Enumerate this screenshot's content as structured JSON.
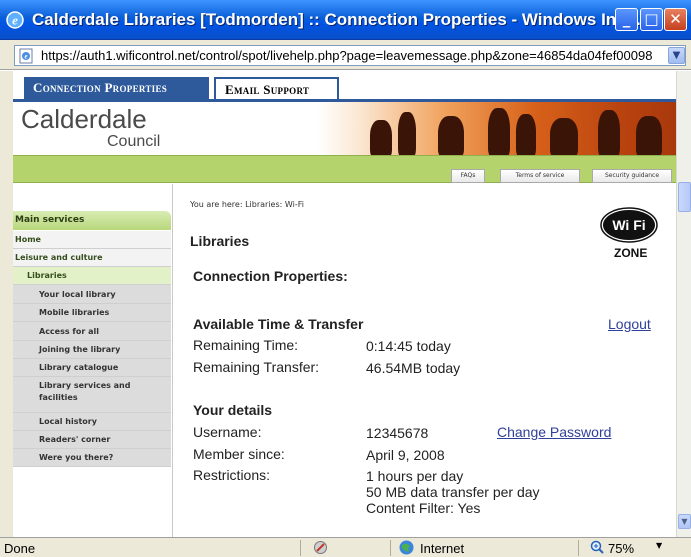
{
  "window": {
    "title": "Calderdale Libraries [Todmorden] :: Connection Properties - Windows Inte...",
    "min_glyph": "_",
    "max_glyph": "□",
    "close_glyph": "✕"
  },
  "address_bar": {
    "url": "https://auth1.wificontrol.net/control/spot/livehelp.php?page=leavemessage.php&zone=46854da04fef00098",
    "dropdown_glyph": "▼"
  },
  "tabs": [
    {
      "label": "Connection Properties"
    },
    {
      "label": "Email Support"
    }
  ],
  "header": {
    "logo_line1": "Calderdale",
    "logo_line2": "Council"
  },
  "top_nav": [
    {
      "label": "FAQs"
    },
    {
      "label": "Terms of service"
    },
    {
      "label": "Security guidance"
    }
  ],
  "sidebar": {
    "heading": "Main services",
    "items": [
      {
        "label": "Home"
      },
      {
        "label": "Leisure and culture"
      },
      {
        "label": "Libraries"
      },
      {
        "label": "Your local library"
      },
      {
        "label": "Mobile libraries"
      },
      {
        "label": "Access for all"
      },
      {
        "label": "Joining the library"
      },
      {
        "label": "Library catalogue"
      },
      {
        "label": "Library services and facilities"
      },
      {
        "label": "Local history"
      },
      {
        "label": "Readers' corner"
      },
      {
        "label": "Were you there?"
      }
    ]
  },
  "main": {
    "breadcrumb": "You are here: Libraries: Wi-Fi",
    "title": "Libraries",
    "section_connection": "Connection Properties:",
    "section_time": "Available Time & Transfer",
    "logout_label": "Logout",
    "remaining_time_label": "Remaining Time:",
    "remaining_time_value": "0:14:45 today",
    "remaining_transfer_label": "Remaining Transfer:",
    "remaining_transfer_value": "46.54MB today",
    "section_details": "Your details",
    "username_label": "Username:",
    "username_value": "12345678",
    "change_password_label": "Change Password",
    "member_since_label": "Member since:",
    "member_since_value": "April 9, 2008",
    "restrictions_label": "Restrictions:",
    "restrictions": [
      "1 hours per day",
      "50 MB data transfer per day",
      "Content Filter: Yes"
    ],
    "wifi_text": "Wi Fi",
    "wifi_zone": "ZONE"
  },
  "status_bar": {
    "status": "Done",
    "zone": "Internet",
    "zoom": "75%",
    "zoom_dropdown": "▼"
  },
  "colors": {
    "title_bar": "#0a5fd8",
    "tab_active": "#2e5a9c",
    "nav_green": "#b4d36c",
    "link": "#2f3f9a"
  }
}
